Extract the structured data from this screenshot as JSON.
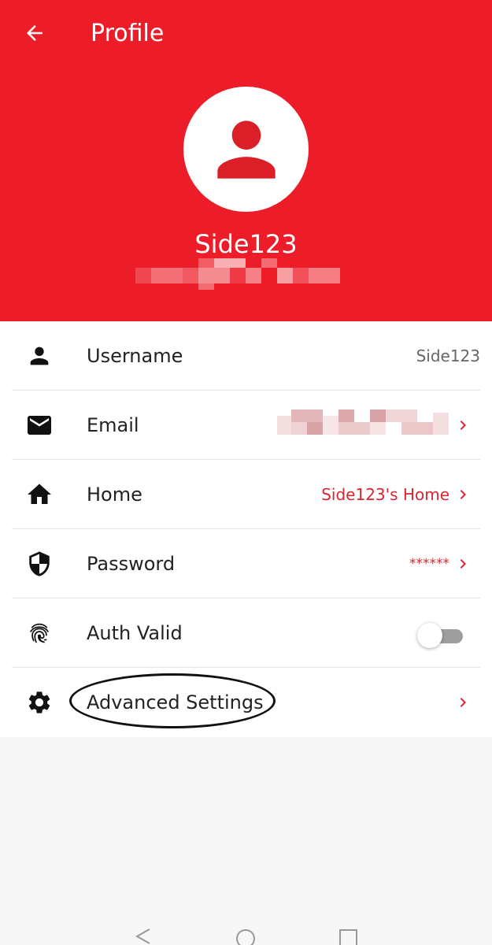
{
  "header": {
    "title": "Profile",
    "profile_name": "Side123",
    "background_color": "#ec1c28",
    "back_icon": "arrow-left-icon",
    "avatar_icon": "person-icon"
  },
  "rows": [
    {
      "label": "Username",
      "value": "Side123",
      "icon": "person-icon"
    },
    {
      "label": "Email",
      "value": "",
      "icon": "mail-icon",
      "chevron": true
    },
    {
      "label": "Home",
      "value": "Side123's Home",
      "icon": "home-icon",
      "chevron": true
    },
    {
      "label": "Password",
      "value": "******",
      "icon": "shield-icon",
      "chevron": true
    },
    {
      "label": "Auth Valid",
      "icon": "fingerprint-icon",
      "toggle": "off"
    },
    {
      "label": "Advanced Settings",
      "icon": "gear-icon",
      "chevron": true
    }
  ],
  "accent_color": "#d7262f",
  "navbar": {
    "icons": [
      "back-triangle-icon",
      "home-circle-icon",
      "recents-square-icon"
    ]
  }
}
